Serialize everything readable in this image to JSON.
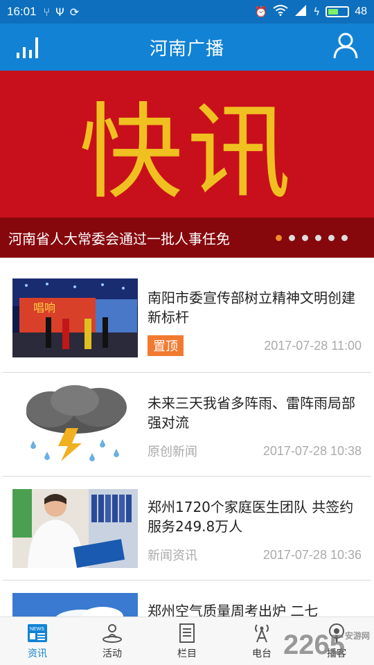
{
  "status_bar": {
    "time": "16:01",
    "battery_level": "48"
  },
  "app_bar": {
    "title": "河南广播",
    "left_icon": "signal-bars-icon",
    "right_icon": "user-profile-icon"
  },
  "banner": {
    "headline_image_text": "快讯",
    "caption": "河南省人大常委会通过一批人事任免",
    "dot_count": 6,
    "active_dot": 1
  },
  "news": [
    {
      "title": "南阳市委宣传部树立精神文明创建新标杆",
      "tag": "置顶",
      "source": "",
      "time": "2017-07-28 11:00"
    },
    {
      "title": "未来三天我省多阵雨、雷阵雨局部强对流",
      "tag": "",
      "source": "原创新闻",
      "time": "2017-07-28 10:38"
    },
    {
      "title": "郑州1720个家庭医生团队 共签约服务249.8万人",
      "tag": "",
      "source": "新闻资讯",
      "time": "2017-07-28 10:36"
    },
    {
      "title": "郑州空气质量周考出炉 二七",
      "tag": "",
      "source": "",
      "time": ""
    }
  ],
  "tabs": [
    {
      "label": "资讯",
      "icon": "news-icon",
      "active": true
    },
    {
      "label": "活动",
      "icon": "activity-icon",
      "active": false
    },
    {
      "label": "栏目",
      "icon": "column-icon",
      "active": false
    },
    {
      "label": "电台",
      "icon": "radio-tower-icon",
      "active": false
    },
    {
      "label": "播客",
      "icon": "podcast-icon",
      "active": false
    }
  ],
  "watermark": {
    "number": "2265",
    "site": "安游网"
  },
  "colors": {
    "header_blue": "#1283d4",
    "banner_red": "#c8101c",
    "banner_text_gold": "#f0c020",
    "tag_orange": "#f27a30"
  }
}
